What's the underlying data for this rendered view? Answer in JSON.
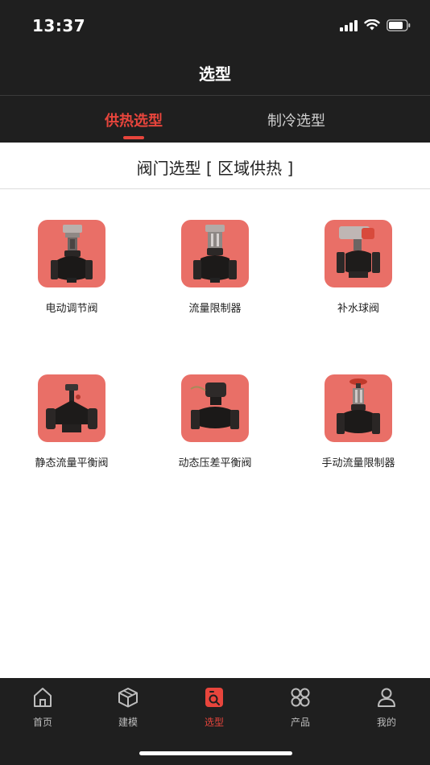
{
  "status_bar": {
    "time": "13:37",
    "icons": [
      "signal-icon",
      "wifi-icon",
      "battery-icon"
    ]
  },
  "header": {
    "title": "选型"
  },
  "tabs": [
    {
      "label": "供热选型",
      "active": true
    },
    {
      "label": "制冷选型",
      "active": false
    }
  ],
  "section": {
    "title": "阀门选型 [ 区域供热 ]"
  },
  "products": [
    {
      "label": "电动调节阀",
      "icon": "electric-control-valve-image"
    },
    {
      "label": "流量限制器",
      "icon": "flow-limiter-image"
    },
    {
      "label": "补水球阀",
      "icon": "makeup-water-ball-valve-image"
    },
    {
      "label": "静态流量平衡阀",
      "icon": "static-balance-valve-image"
    },
    {
      "label": "动态压差平衡阀",
      "icon": "dynamic-pressure-valve-image"
    },
    {
      "label": "手动流量限制器",
      "icon": "manual-flow-limiter-image"
    }
  ],
  "tabbar": [
    {
      "label": "首页",
      "icon": "home-icon",
      "active": false
    },
    {
      "label": "建模",
      "icon": "cube-icon",
      "active": false
    },
    {
      "label": "选型",
      "icon": "selection-search-icon",
      "active": true
    },
    {
      "label": "产品",
      "icon": "grid-apps-icon",
      "active": false
    },
    {
      "label": "我的",
      "icon": "user-icon",
      "active": false
    }
  ],
  "colors": {
    "accent": "#e8453c",
    "header_bg": "#1f1f1f",
    "thumb_bg": "#e96f67"
  }
}
